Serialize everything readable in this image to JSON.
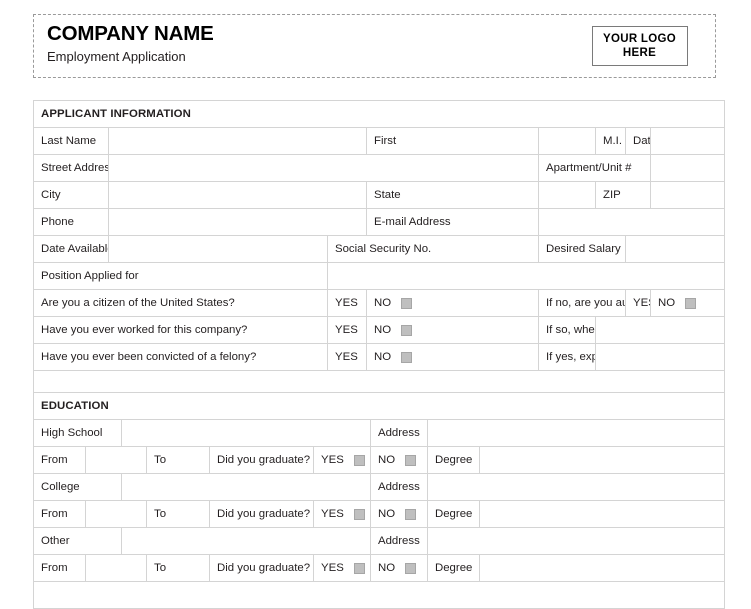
{
  "header": {
    "company_name": "COMPANY NAME",
    "tagline": "Employment Application",
    "logo_line1": "YOUR LOGO",
    "logo_line2": "HERE"
  },
  "applicant_section": {
    "title": "APPLICANT INFORMATION",
    "labels": {
      "last_name": "Last Name",
      "first": "First",
      "middle_initial": "M.I.",
      "date": "Date",
      "street_address": "Street Address",
      "apartment_unit": "Apartment/Unit #",
      "city": "City",
      "state": "State",
      "zip": "ZIP",
      "phone": "Phone",
      "email": "E-mail Address",
      "date_available": "Date Available",
      "social_security": "Social Security No.",
      "desired_salary": "Desired Salary",
      "position_applied": "Position Applied for"
    },
    "questions": [
      {
        "prompt": "Are you a citizen of the United States?",
        "yes": "YES",
        "no": "NO",
        "followup": "If no, are you authorized to work in the U.S.?",
        "followup_yes": "YES",
        "followup_no": "NO"
      },
      {
        "prompt": "Have you ever worked for this company?",
        "yes": "YES",
        "no": "NO",
        "followup": "If so, when?"
      },
      {
        "prompt": "Have you ever been convicted of a felony?",
        "yes": "YES",
        "no": "NO",
        "followup": "If yes, explain"
      }
    ]
  },
  "education_section": {
    "title": "EDUCATION",
    "labels": {
      "address": "Address",
      "from": "From",
      "to": "To",
      "did_you_graduate": "Did you graduate?",
      "yes": "YES",
      "no": "NO",
      "degree": "Degree"
    },
    "entries": [
      {
        "name": "High School"
      },
      {
        "name": "College"
      },
      {
        "name": "Other"
      }
    ]
  }
}
